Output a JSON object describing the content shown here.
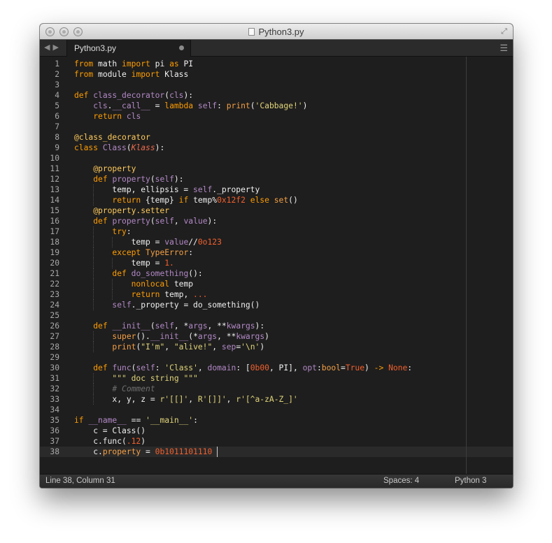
{
  "window": {
    "title": "Python3.py"
  },
  "tabs": [
    {
      "label": "Python3.py",
      "modified": true
    }
  ],
  "status": {
    "position": "Line 38, Column 31",
    "spaces": "Spaces: 4",
    "syntax": "Python 3"
  },
  "editor": {
    "current_line": 38,
    "line_numbers": [
      "1",
      "2",
      "3",
      "4",
      "5",
      "6",
      "7",
      "8",
      "9",
      "10",
      "11",
      "12",
      "13",
      "14",
      "15",
      "16",
      "17",
      "18",
      "19",
      "20",
      "21",
      "22",
      "23",
      "24",
      "25",
      "26",
      "27",
      "28",
      "29",
      "30",
      "31",
      "32",
      "33",
      "34",
      "35",
      "36",
      "37",
      "38"
    ],
    "lines": [
      "from math import pi as PI",
      "from module import Klass",
      "",
      "def class_decorator(cls):",
      "    cls.__call__ = lambda self: print('Cabbage!')",
      "    return cls",
      "",
      "@class_decorator",
      "class Class(Klass):",
      "",
      "    @property",
      "    def property(self):",
      "        temp, ellipsis = self._property",
      "        return {temp} if temp%0x12f2 else set()",
      "    @property.setter",
      "    def property(self, value):",
      "        try:",
      "            temp = value//0o123",
      "        except TypeError:",
      "            temp = 1.",
      "        def do_something():",
      "            nonlocal temp",
      "            return temp, ...",
      "        self._property = do_something()",
      "",
      "    def __init__(self, *args, **kwargs):",
      "        super().__init__(*args, **kwargs)",
      "        print(\"I'm\", \"alive!\", sep='\\n')",
      "",
      "    def func(self: 'Class', domain: [0b00, PI], opt:bool=True) -> None:",
      "        \"\"\" doc string \"\"\"",
      "        # Comment",
      "        x, y, z = r'[[]', R'[]]', r'[^a-zA-Z_]'",
      "",
      "if __name__ == '__main__':",
      "    c = Class()",
      "    c.func(.12)",
      "    c.property = 0b1011101110 "
    ]
  },
  "colors": {
    "keyword": "#ff9d00",
    "string": "#e0d47a",
    "number": "#f2602d",
    "function_name": "#b389c7",
    "comment": "#6e6e6e",
    "background": "#1e1e1e"
  },
  "icons": {
    "close": "close-button-icon",
    "minimize": "minimize-button-icon",
    "zoom": "zoom-button-icon",
    "fullscreen": "fullscreen-icon",
    "back": "back-arrow-icon",
    "forward": "forward-arrow-icon",
    "menu": "hamburger-menu-icon"
  }
}
